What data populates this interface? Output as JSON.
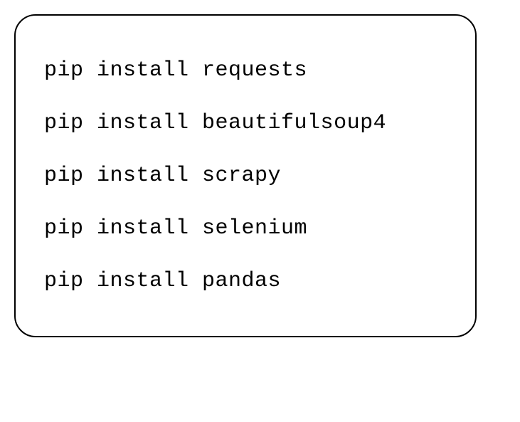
{
  "commands": [
    "pip install requests",
    "pip install beautifulsoup4",
    "pip install scrapy",
    "pip install selenium",
    "pip install pandas"
  ]
}
